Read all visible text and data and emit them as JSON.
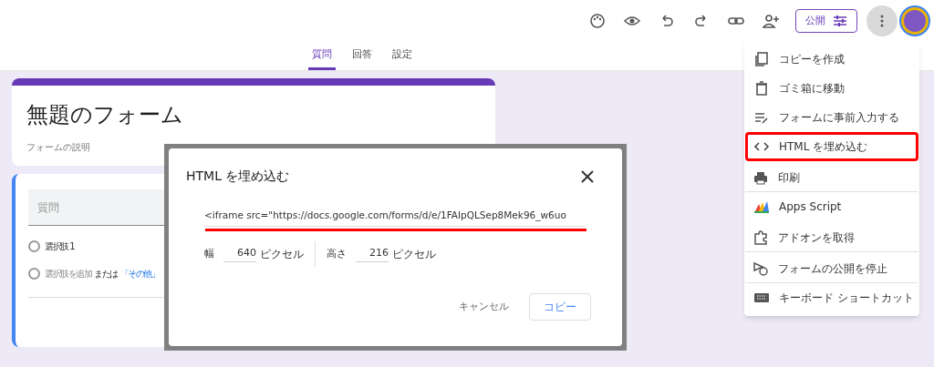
{
  "toolbar": {
    "publish_button": "公開"
  },
  "tabs": [
    {
      "label": "質問",
      "selected": true
    },
    {
      "label": "回答",
      "selected": false
    },
    {
      "label": "設定",
      "selected": false
    }
  ],
  "form": {
    "title": "無題のフォーム",
    "description": "フォームの説明"
  },
  "question": {
    "placeholder": "質問",
    "options": [
      {
        "kind": "option",
        "label": "選択肢 1",
        "selected": false
      },
      {
        "kind": "add",
        "label": "選択肢を追加",
        "middle": "または",
        "link": "「その他」",
        "selected": false
      }
    ]
  },
  "dialog": {
    "title": "HTML を埋め込む",
    "embed_code": "<iframe src=\"https://docs.google.com/forms/d/e/1FAIpQLSep8Mek96_w6uo",
    "underlined": true,
    "width_label": "幅",
    "width_value": "640",
    "width_unit": "ピクセル",
    "height_label": "高さ",
    "height_value": "216",
    "height_unit": "ピクセル",
    "cancel": "キャンセル",
    "copy": "コピー"
  },
  "menu": [
    {
      "label": "コピーを作成",
      "highlighted": false,
      "divider_after": false
    },
    {
      "label": "ゴミ箱に移動",
      "highlighted": false,
      "divider_after": false
    },
    {
      "label": "フォームに事前入力する",
      "highlighted": false,
      "divider_after": false
    },
    {
      "label": "HTML を埋め込む",
      "highlighted": true,
      "divider_after": false
    },
    {
      "label": "印刷",
      "highlighted": false,
      "divider_after": true
    },
    {
      "label": "Apps Script",
      "highlighted": false,
      "divider_after": false
    },
    {
      "label": "アドオンを取得",
      "highlighted": false,
      "divider_after": true
    },
    {
      "label": "フォームの公開を停止",
      "highlighted": false,
      "divider_after": true
    },
    {
      "label": "キーボード ショートカット",
      "highlighted": false,
      "divider_after": false
    }
  ]
}
